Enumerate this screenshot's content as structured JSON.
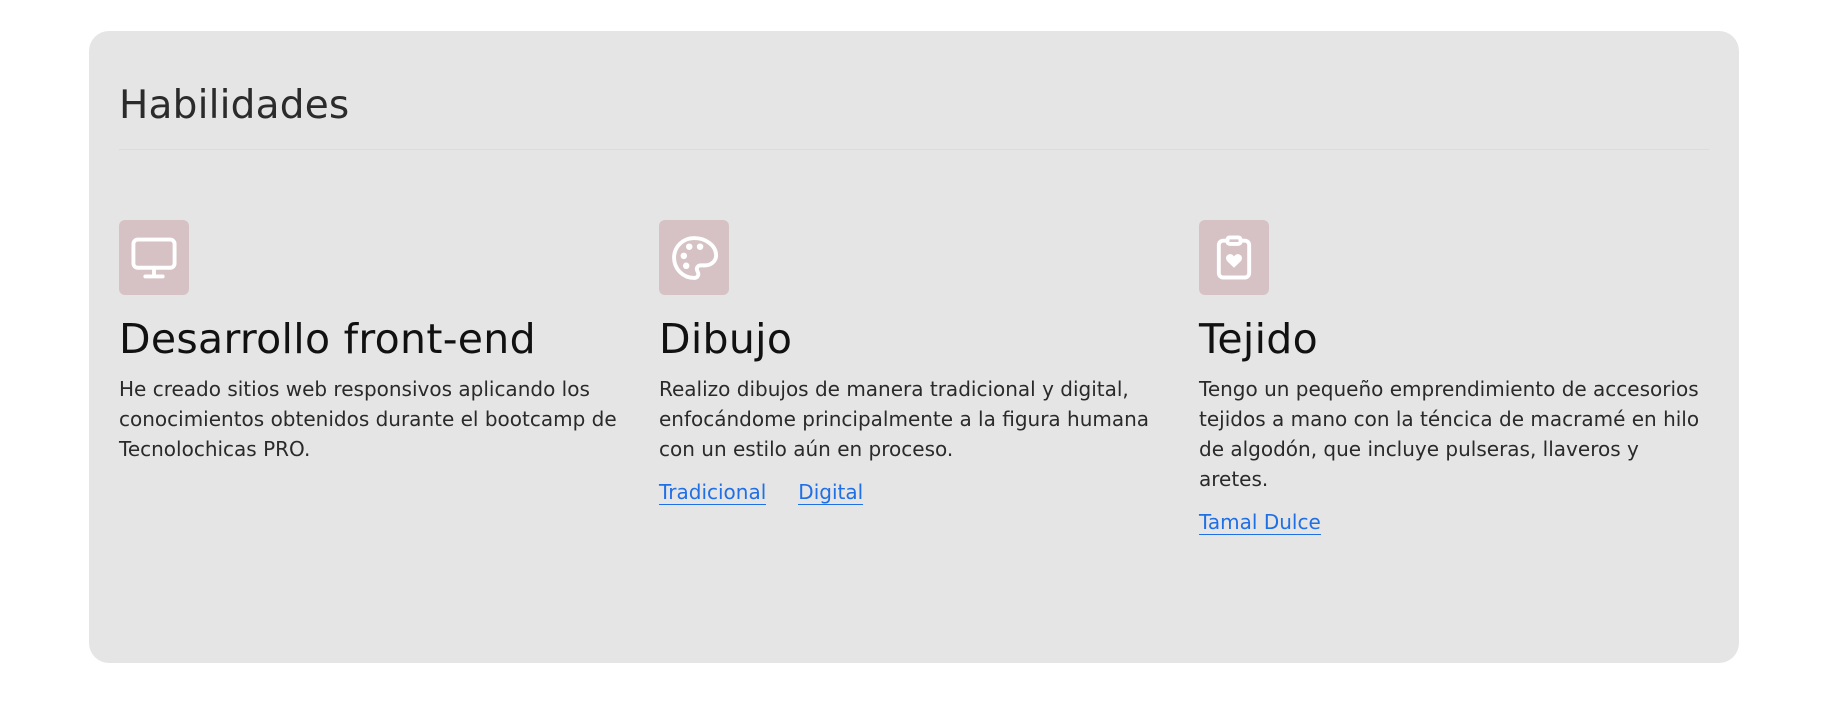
{
  "section": {
    "title": "Habilidades"
  },
  "skills": [
    {
      "icon": "monitor-icon",
      "title": "Desarrollo front-end",
      "description": "He creado sitios web responsivos aplicando los conocimientos obtenidos durante el bootcamp de Tecnolochicas PRO.",
      "links": []
    },
    {
      "icon": "palette-icon",
      "title": "Dibujo",
      "description": "Realizo dibujos de manera tradicional y digital, enfocándome principalmente a la figura humana con un estilo aún en proceso.",
      "links": [
        "Tradicional",
        "Digital"
      ]
    },
    {
      "icon": "clipboard-heart-icon",
      "title": "Tejido",
      "description": "Tengo un pequeño emprendimiento de accesorios tejidos a mano con la téncica de macramé en hilo de algodón, que incluye pulseras, llaveros y aretes.",
      "links": [
        "Tamal Dulce"
      ]
    }
  ],
  "colors": {
    "panel_background": "#e5e5e5",
    "icon_background": "#d6c2c5",
    "link": "#1f6fe5"
  }
}
